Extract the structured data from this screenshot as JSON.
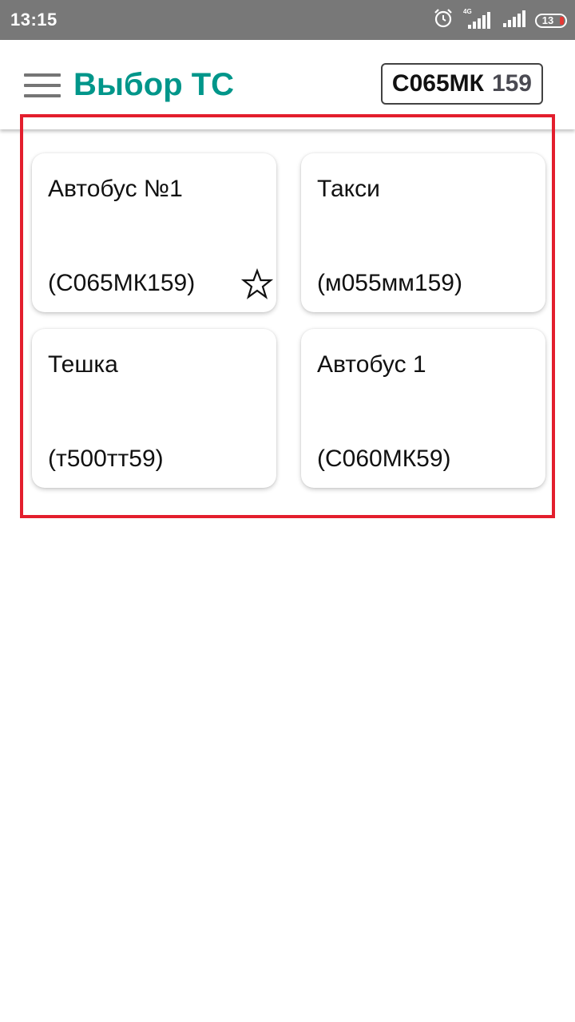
{
  "status_bar": {
    "time": "13:15",
    "network": "4G",
    "battery": "13",
    "icons": [
      "alarm-icon",
      "signal-icon",
      "signal-icon",
      "battery-icon"
    ],
    "battery_color": "#e53935"
  },
  "header": {
    "title": "Выбор ТС",
    "title_color": "#00968a",
    "plate": {
      "number": "С065МК",
      "region": "159"
    }
  },
  "vehicles": [
    {
      "name": "Автобус №1",
      "plate": "(С065МК159)",
      "favorite": true
    },
    {
      "name": "Такси",
      "plate": "(м055мм159)",
      "favorite": false
    },
    {
      "name": "Тешка",
      "plate": "(т500тт59)",
      "favorite": false
    },
    {
      "name": "Автобус 1",
      "plate": "(С060МК59)",
      "favorite": false
    }
  ],
  "highlight_color": "#e31e2d"
}
